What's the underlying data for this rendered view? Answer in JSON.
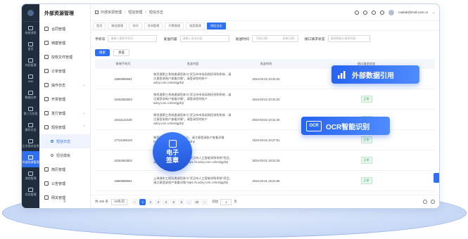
{
  "app": {
    "title": "外部资源管理",
    "account": "mailab@tmdl.com.cn"
  },
  "rail": [
    {
      "label": "系统消息"
    },
    {
      "label": "首页"
    },
    {
      "label": "内容管理"
    },
    {
      "label": "IAM"
    },
    {
      "label": "数据仓库"
    },
    {
      "label": "第三方应用"
    },
    {
      "label": "操作日志"
    },
    {
      "label": "企业基本信息"
    },
    {
      "label": "外部资源管理"
    },
    {
      "label": "流程管理"
    },
    {
      "label": "任务管理"
    }
  ],
  "menu": [
    {
      "label": "合同管理"
    },
    {
      "label": "档案管理"
    },
    {
      "label": "授权文件管理"
    },
    {
      "label": "订单管理"
    },
    {
      "label": "操作日志",
      "arrow": "⌄"
    },
    {
      "label": "开票管理"
    },
    {
      "label": "发行管理",
      "arrow": "⌄"
    },
    {
      "label": "短信管理",
      "arrow": "⌃"
    },
    {
      "label": "短信日志",
      "sub": true,
      "selected": true
    },
    {
      "label": "短信模板",
      "sub": true
    },
    {
      "label": "简历管理"
    },
    {
      "label": "公告管理"
    },
    {
      "label": "网关管理"
    }
  ],
  "breadcrumb": [
    "外部资源管理",
    "短信管理",
    "短信日志"
  ],
  "tabs": [
    "首页",
    "服务管理",
    "合同",
    "合同管理",
    "开票管理",
    "档案管理",
    "短信日志"
  ],
  "filters": {
    "phone_label": "手机号",
    "phone_placeholder": "请输入接收手机号",
    "content_label": "发送内容",
    "content_placeholder": "请输入发送内容",
    "time_label": "发送时间",
    "time_start": "开始日期",
    "time_end": "结束日期",
    "status_label": "接口请求状态",
    "status_placeholder": "请选择接口请求状态"
  },
  "buttons": {
    "search": "搜索",
    "reset": "重置"
  },
  "table": {
    "headers": [
      "接收手机号",
      "发送内容",
      "发送时间",
      "接口请求状态"
    ],
    "rows": [
      {
        "phone": "18565899061",
        "content": "物资通第三系统邀请您参与“武汉市市场局购招采购系统…请注意登录账户查看详情”，请登录您的账户 wdzy.com.cn/test/gjdhjl",
        "time": "2024-03-22 10:31:20",
        "status": "正常"
      },
      {
        "phone": "18162602823",
        "content": "物资通第三系统邀请您参与“武汉市市场局购招采购系统…请注意登录账户查看详情”，请登录您的账户 wdzy.com.cn/test/gjdhjl",
        "time": "2024-03-22 10:31:20",
        "status": "正常"
      },
      {
        "phone": "18151122180",
        "content": "物资通第三系统邀请您参与“武汉市市场局购招采购系统…请注意登录账户查看详情”，请登录您的账户 wdzy.com.cn/test/gjdhjl",
        "time": "2024-03-22 10:31:20",
        "status": "正常"
      },
      {
        "phone": "17721266103",
        "content": "物资通第三系统邀请您参与，请注意登录账户查看详情 https://s.wdzy.com.cn/test/gjdhjl",
        "time": "2024-03-22 10:27:01",
        "status": "正常"
      },
      {
        "phone": "18162602823",
        "content": "上海浦东工程局邀请您参与“武汉市人工智能采购系统”项目，请注意登录账户查看详情 https://s.wdzy.com.cn/test/gjdhjl",
        "time": "2024-03-21 18:22:28",
        "status": "正常"
      },
      {
        "phone": "18565899061",
        "content": "上海浦东工程局邀请您参与“武汉市人工智能采购系统”项目，请注意登录账户查看详情 https://s.wdzy.com.cn/test/gjdhjl",
        "time": "2024-03-21 18:22:28",
        "status": "正常"
      }
    ]
  },
  "pager": {
    "total": "共 490 条",
    "size": "10条/页",
    "pages": [
      "1",
      "2",
      "3",
      "4",
      "5",
      "6",
      "...",
      "49"
    ],
    "current": "1",
    "goto_label": "前往",
    "goto_value": "1",
    "page_suffix": "页"
  },
  "callouts": {
    "external": "外部数据引用",
    "ocr_badge": "OCR",
    "ocr": "OCR智能识别",
    "seal_line1": "电子",
    "seal_line2": "签章"
  },
  "colors": {
    "accent": "#2f6ff2",
    "sidebar": "#1f2d3d",
    "status_ok": "#3aa95b"
  }
}
